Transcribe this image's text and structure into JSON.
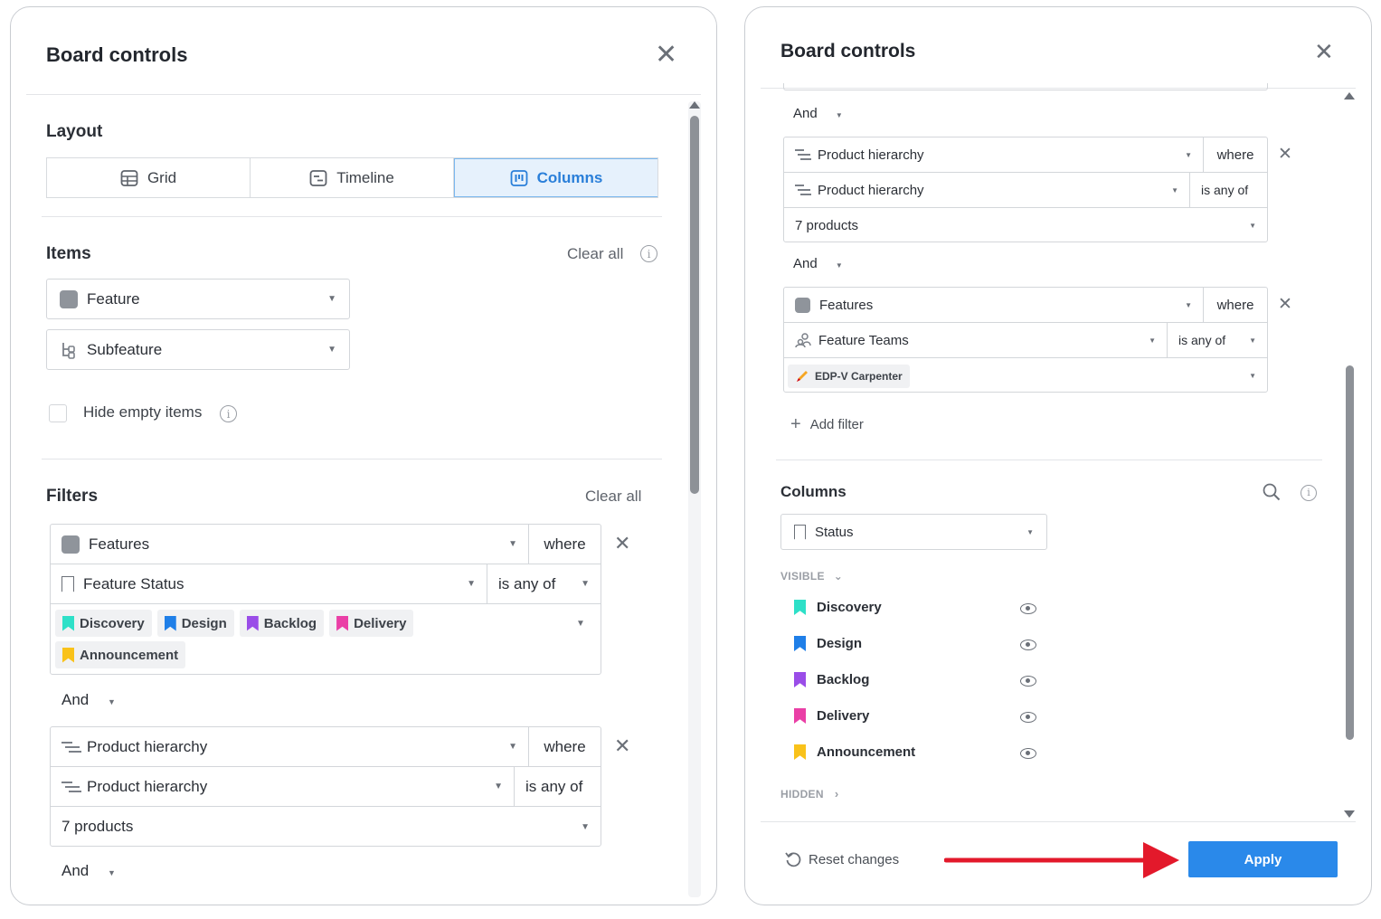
{
  "left": {
    "title": "Board controls",
    "layout": {
      "title": "Layout",
      "options": [
        "Grid",
        "Timeline",
        "Columns"
      ],
      "active": "Columns"
    },
    "items": {
      "title": "Items",
      "clear_all": "Clear all",
      "selects": [
        "Feature",
        "Subfeature"
      ],
      "hide_empty_label": "Hide empty items"
    },
    "filters": {
      "title": "Filters",
      "clear_all": "Clear all",
      "block1": {
        "entity": "Features",
        "where": "where",
        "field": "Feature Status",
        "op": "is any of",
        "chips": [
          {
            "label": "Discovery",
            "color": "#2ee0c8"
          },
          {
            "label": "Design",
            "color": "#1f7fe8"
          },
          {
            "label": "Backlog",
            "color": "#9a4de8"
          },
          {
            "label": "Delivery",
            "color": "#ea3fa6"
          },
          {
            "label": "Announcement",
            "color": "#f9c21a"
          }
        ]
      },
      "and1": "And",
      "block2": {
        "entity": "Product hierarchy",
        "where": "where",
        "field": "Product hierarchy",
        "op": "is any of",
        "value": "7 products"
      },
      "and2": "And"
    }
  },
  "right": {
    "title": "Board controls",
    "and1": "And",
    "block1": {
      "entity": "Product hierarchy",
      "where": "where",
      "field": "Product hierarchy",
      "op": "is any of",
      "value": "7 products"
    },
    "and2": "And",
    "block2": {
      "entity": "Features",
      "where": "where",
      "field": "Feature Teams",
      "op": "is any of",
      "chip": "EDP-V Carpenter"
    },
    "add_filter": "Add filter",
    "columns": {
      "title": "Columns",
      "select": "Status",
      "visible_label": "VISIBLE",
      "hidden_label": "HIDDEN",
      "items": [
        {
          "label": "Discovery",
          "color": "#2ee0c8"
        },
        {
          "label": "Design",
          "color": "#1f7fe8"
        },
        {
          "label": "Backlog",
          "color": "#9a4de8"
        },
        {
          "label": "Delivery",
          "color": "#ea3fa6"
        },
        {
          "label": "Announcement",
          "color": "#f9c21a"
        }
      ]
    },
    "reset_label": "Reset changes",
    "apply_label": "Apply"
  }
}
